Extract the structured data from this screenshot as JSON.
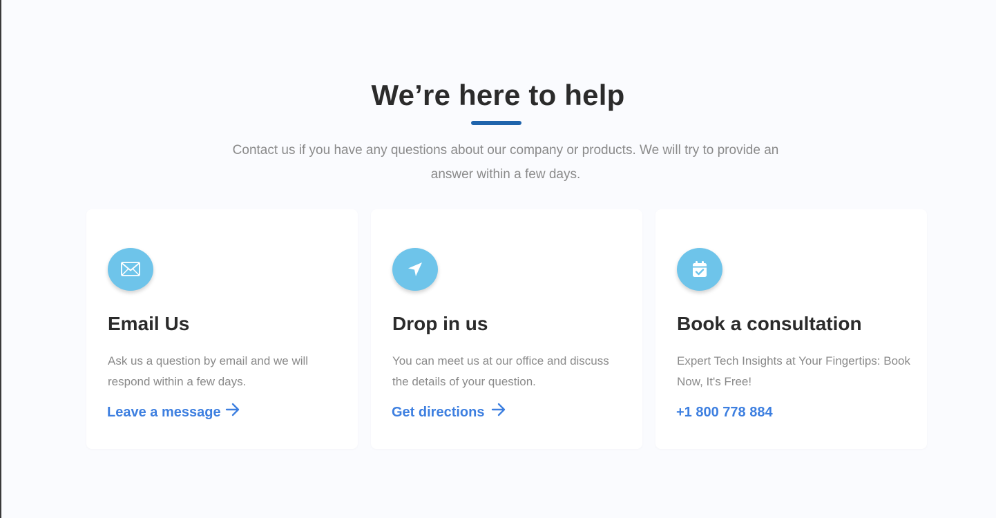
{
  "header": {
    "title": "We’re here to help",
    "subtitle": "Contact us if you have any questions about our company or products. We will try to provide an answer within a few days."
  },
  "colors": {
    "accent": "#1f64ac",
    "icon_bg": "#6ec4ea",
    "link": "#3d7fe0",
    "heading": "#2b2b2b",
    "muted_text": "#8a8a8a",
    "page_bg": "#fafbfe"
  },
  "cards": [
    {
      "icon": "envelope-icon",
      "title": "Email Us",
      "text": "Ask us a question by email and we will respond within a few days.",
      "link_label": "Leave a message",
      "link_icon": "arrow-right-icon"
    },
    {
      "icon": "navigation-arrow-icon",
      "title": "Drop in us",
      "text": "You can meet us at our office and discuss the details of your question.",
      "link_label": "Get directions",
      "link_icon": "arrow-right-icon"
    },
    {
      "icon": "calendar-check-icon",
      "title": "Book a consultation",
      "text": "Expert Tech Insights at Your Fingertips: Book Now, It's Free!",
      "link_label": "+1 800 778 884"
    }
  ]
}
